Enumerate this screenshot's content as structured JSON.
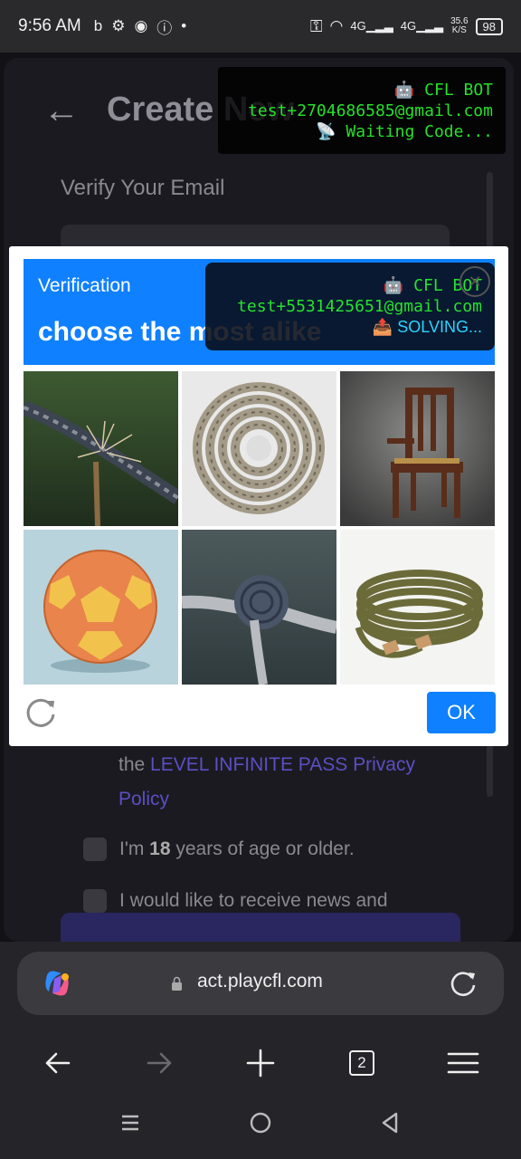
{
  "status_bar": {
    "time": "9:56 AM",
    "net_speed_value": "35.6",
    "net_speed_unit": "K/S",
    "signal_1": "4G",
    "signal_2": "4G",
    "battery": "98"
  },
  "background_page": {
    "title": "Create New",
    "subtitle": "Verify Your Email",
    "privacy_prefix": "the ",
    "privacy_link": "LEVEL INFINITE PASS Privacy Policy",
    "age_check_pre": "I'm ",
    "age_check_bold": "18",
    "age_check_post": " years of age or older.",
    "news_check": "I would like to receive news and"
  },
  "bot_overlay_top": {
    "line1": "🤖 CFL BOT",
    "line2": "test+2704686585@gmail.com",
    "line3": "📡 Waiting Code..."
  },
  "captcha": {
    "small_title": "Verification",
    "big_title": "choose the most alike",
    "ok_label": "OK",
    "tiles": [
      "frayed-rope-tile",
      "coiled-rope-tile",
      "wooden-chair-tile",
      "soccer-ball-tile",
      "rope-knot-tile",
      "green-rope-coil-tile"
    ]
  },
  "bot_overlay_mid": {
    "line1": "🤖 CFL BOT",
    "line2": "test+5531425651@gmail.com",
    "line3": "📤 SOLVING..."
  },
  "browser": {
    "url": "act.playcfl.com",
    "tab_count": "2"
  },
  "colors": {
    "captcha_blue": "#0f80ff",
    "bot_green": "#26e02b",
    "link_purple": "#5a4fc4"
  }
}
